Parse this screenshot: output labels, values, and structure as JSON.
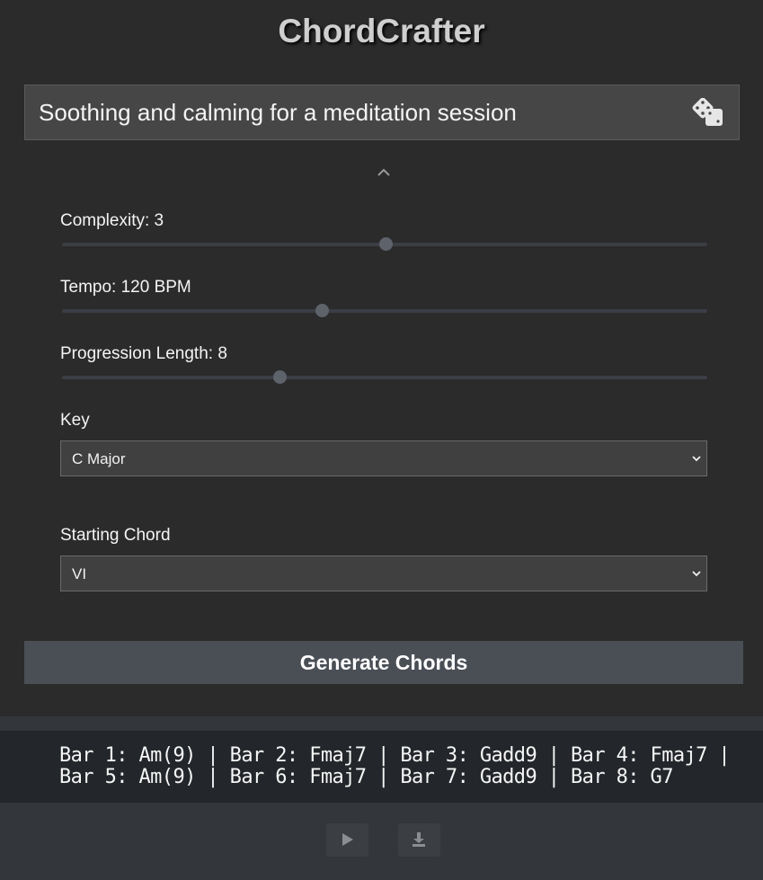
{
  "app": {
    "title": "ChordCrafter"
  },
  "prompt": {
    "text": "Soothing and calming for a meditation session"
  },
  "controls": {
    "complexity": {
      "label": "Complexity: 3",
      "value": 3,
      "min": 1,
      "max": 5
    },
    "tempo": {
      "label": "Tempo: 120 BPM",
      "value": 120,
      "min": 60,
      "max": 200
    },
    "length": {
      "label": "Progression Length: 8",
      "value": 8,
      "min": 4,
      "max": 16
    },
    "key": {
      "label": "Key",
      "selected": "C Major"
    },
    "starting_chord": {
      "label": "Starting Chord",
      "selected": "VI"
    }
  },
  "generate_button": {
    "label": "Generate Chords"
  },
  "output": {
    "line1": "Bar 1: Am(9) | Bar 2: Fmaj7 | Bar 3: Gadd9 | Bar 4: Fmaj7 |",
    "line2": "Bar 5: Am(9) | Bar 6: Fmaj7 | Bar 7: Gadd9 | Bar 8: G7"
  },
  "icons": {
    "randomize": "dice-icon",
    "collapse": "chevron-up-icon",
    "play": "play-icon",
    "download": "download-icon"
  }
}
